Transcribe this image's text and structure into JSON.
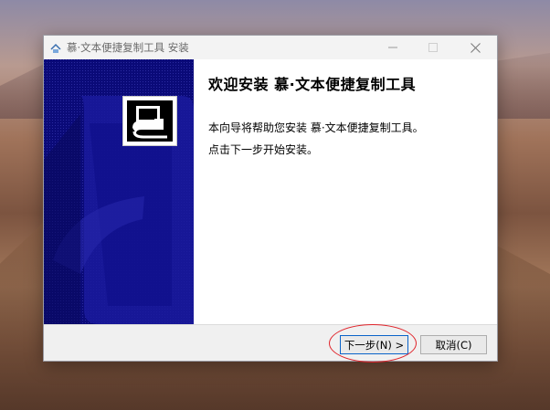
{
  "window": {
    "title": "慕·文本便捷复制工具 安装"
  },
  "content": {
    "heading": "欢迎安装 慕·文本便捷复制工具",
    "line1": "本向导将帮助您安装 慕·文本便捷复制工具。",
    "line2": "点击下一步开始安装。"
  },
  "buttons": {
    "next_label": "下一步(N) >",
    "cancel_label": "取消(C)"
  },
  "icons": {
    "window_icon": "installer-icon",
    "minimize": "minimize-icon",
    "maximize": "maximize-icon",
    "close": "close-icon",
    "product": "product-logo-icon"
  },
  "colors": {
    "banner": "#0a0a78",
    "accent": "#0a63c9",
    "annotation": "#e0242b"
  }
}
